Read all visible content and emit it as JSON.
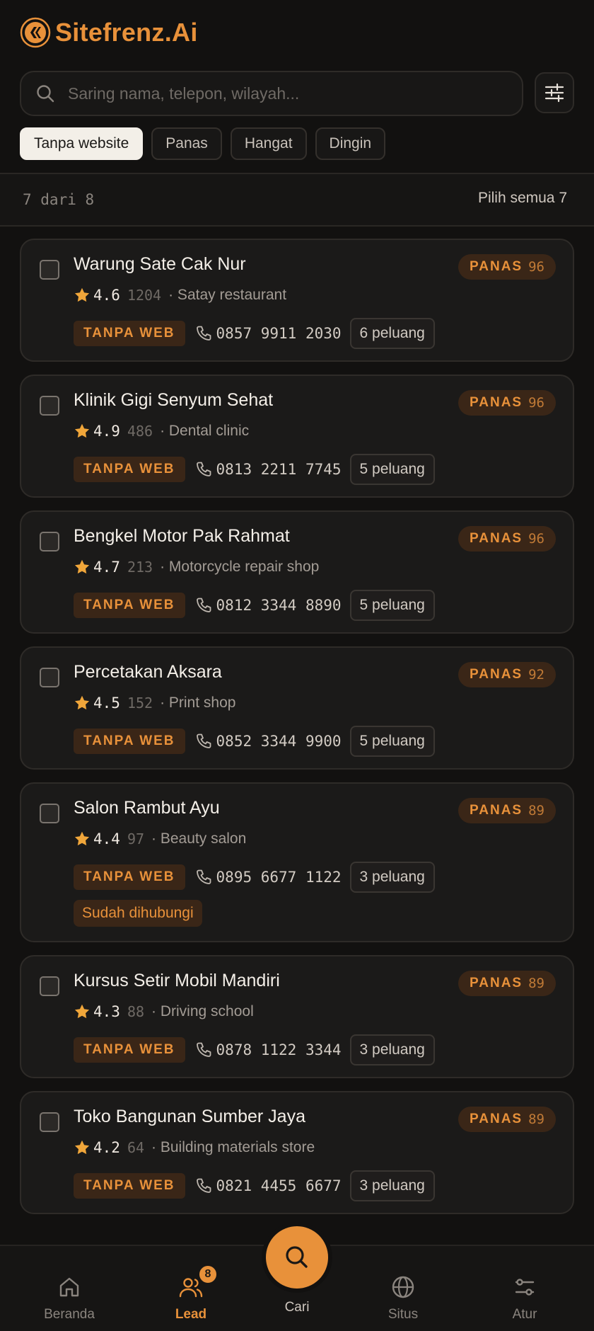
{
  "app": {
    "brand": "Sitefrenz.Ai"
  },
  "search": {
    "placeholder": "Saring nama, telepon, wilayah..."
  },
  "filters": [
    "Tanpa website",
    "Panas",
    "Hangat",
    "Dingin"
  ],
  "summary": {
    "count_text": "7 dari 8",
    "select_all": "Pilih semua 7"
  },
  "labels": {
    "hot": "PANAS",
    "no_web": "TANPA WEB"
  },
  "leads": [
    {
      "name": "Warung Sate Cak Nur",
      "score": "96",
      "rating": "4.6",
      "reviews": "1204",
      "category": "· Satay restaurant",
      "phone": "0857 9911 2030",
      "opportunities": "6 peluang"
    },
    {
      "name": "Klinik Gigi Senyum Sehat",
      "score": "96",
      "rating": "4.9",
      "reviews": "486",
      "category": "· Dental clinic",
      "phone": "0813 2211 7745",
      "opportunities": "5 peluang"
    },
    {
      "name": "Bengkel Motor Pak Rahmat",
      "score": "96",
      "rating": "4.7",
      "reviews": "213",
      "category": "· Motorcycle repair shop",
      "phone": "0812 3344 8890",
      "opportunities": "5 peluang"
    },
    {
      "name": "Percetakan Aksara",
      "score": "92",
      "rating": "4.5",
      "reviews": "152",
      "category": "· Print shop",
      "phone": "0852 3344 9900",
      "opportunities": "5 peluang"
    },
    {
      "name": "Salon Rambut Ayu",
      "score": "89",
      "rating": "4.4",
      "reviews": "97",
      "category": "· Beauty salon",
      "phone": "0895 6677 1122",
      "opportunities": "3 peluang",
      "status": "Sudah dihubungi"
    },
    {
      "name": "Kursus Setir Mobil Mandiri",
      "score": "89",
      "rating": "4.3",
      "reviews": "88",
      "category": "· Driving school",
      "phone": "0878 1122 3344",
      "opportunities": "3 peluang"
    },
    {
      "name": "Toko Bangunan Sumber Jaya",
      "score": "89",
      "rating": "4.2",
      "reviews": "64",
      "category": "· Building materials store",
      "phone": "0821 4455 6677",
      "opportunities": "3 peluang"
    }
  ],
  "nav": {
    "home": "Beranda",
    "leads": "Lead",
    "leads_badge": "8",
    "search": "Cari",
    "sites": "Situs",
    "settings": "Atur"
  },
  "colors": {
    "accent": "#e8913a",
    "background": "#121110",
    "card": "#1b1a19",
    "star": "#f0a63a"
  }
}
